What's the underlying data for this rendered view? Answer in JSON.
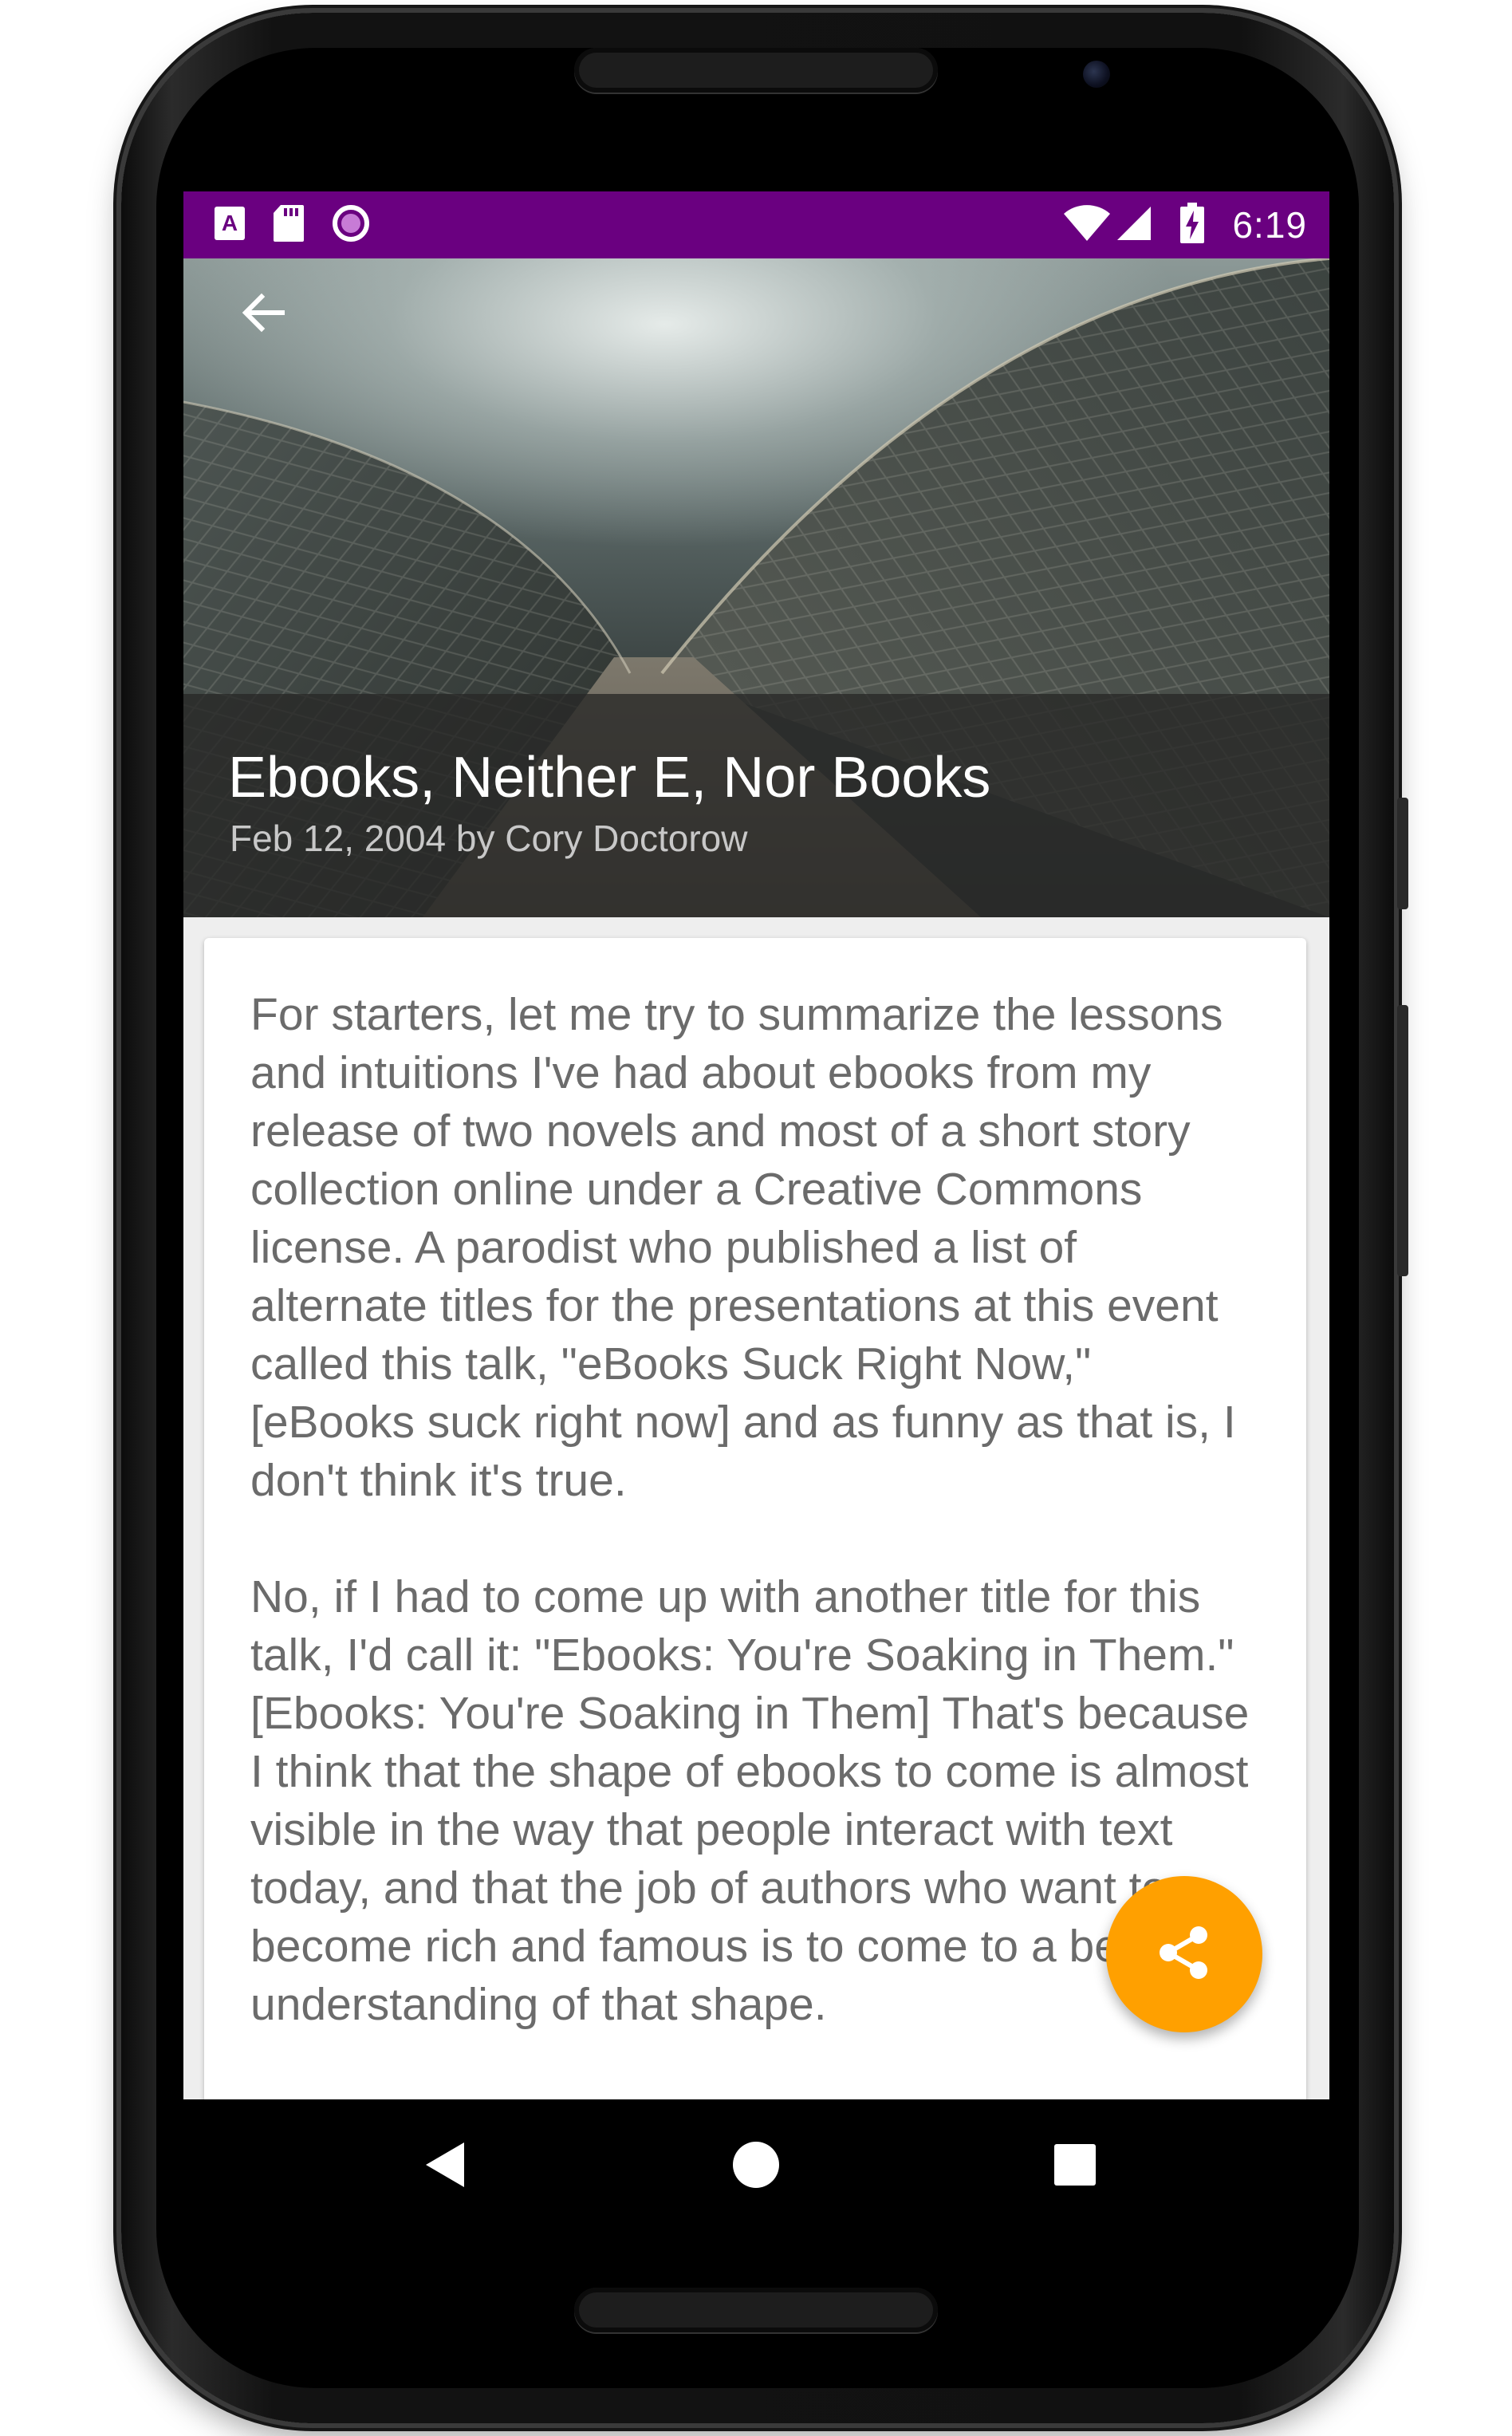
{
  "status_bar": {
    "time": "6:19",
    "left_icons": [
      "font-notification-icon",
      "sd-card-icon",
      "sync-circle-icon"
    ],
    "right_icons": [
      "wifi-icon",
      "cell-signal-icon",
      "battery-charging-icon"
    ],
    "background_color": "#6a0080"
  },
  "toolbar": {
    "back_icon": "arrow-back-icon"
  },
  "article": {
    "title": "Ebooks, Neither E, Nor Books",
    "subtitle": "Feb 12, 2004 by Cory Doctorow",
    "paragraphs": [
      "For starters, let me try to summarize the lessons and intuitions I've had about ebooks from my release of two novels and most of a short story collection online under a Creative Commons license. A parodist who published a list of alternate titles for the presentations at this event called this talk, \"eBooks Suck Right Now,\" [eBooks suck right now] and as funny as that is, I don't think it's true.",
      "No, if I had to come up with another title for this talk, I'd call it: \"Ebooks: You're Soaking in Them.\" [Ebooks: You're Soaking in Them] That's because I think that the shape of ebooks to come is almost visible in the way that people interact with text today, and that the job of authors who want to become rich and famous is to come to a better understanding of that shape."
    ]
  },
  "fab": {
    "icon": "share-icon",
    "color": "#ffa000"
  },
  "navigation": {
    "buttons": [
      "back-triangle-icon",
      "home-circle-icon",
      "recents-square-icon"
    ]
  }
}
